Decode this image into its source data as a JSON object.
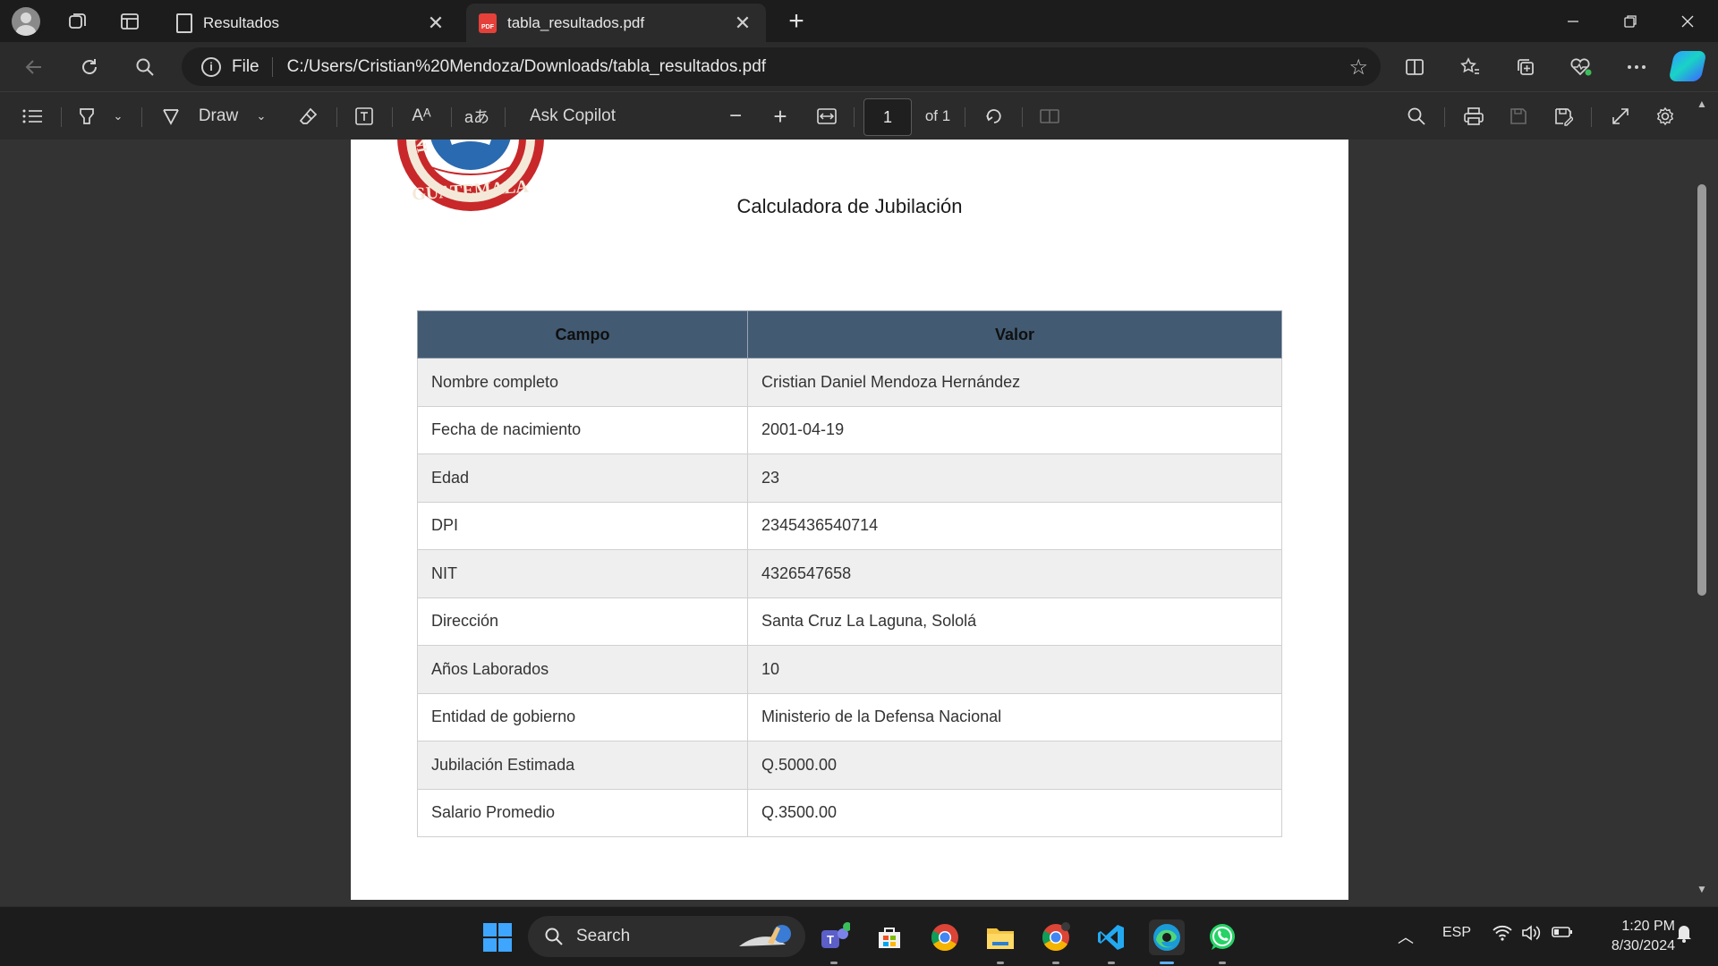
{
  "browser": {
    "tabs": [
      {
        "label": "Resultados",
        "active": false
      },
      {
        "label": "tabla_resultados.pdf",
        "active": true
      }
    ],
    "address": {
      "scheme_label": "File",
      "url": "C:/Users/Cristian%20Mendoza/Downloads/tabla_resultados.pdf"
    }
  },
  "pdf_toolbar": {
    "draw_label": "Draw",
    "ask_copilot_label": "Ask Copilot",
    "page_current": "1",
    "page_total_label": "of 1"
  },
  "document": {
    "title": "Calculadora de Jubilación",
    "seal_text": "GUATEMALA",
    "table": {
      "headers": [
        "Campo",
        "Valor"
      ],
      "rows": [
        {
          "campo": "Nombre completo",
          "valor": "Cristian Daniel Mendoza Hernández"
        },
        {
          "campo": "Fecha de nacimiento",
          "valor": "2001-04-19"
        },
        {
          "campo": "Edad",
          "valor": "23"
        },
        {
          "campo": "DPI",
          "valor": "2345436540714"
        },
        {
          "campo": "NIT",
          "valor": "4326547658"
        },
        {
          "campo": "Dirección",
          "valor": "Santa Cruz La Laguna, Sololá"
        },
        {
          "campo": "Años Laborados",
          "valor": "10"
        },
        {
          "campo": "Entidad de gobierno",
          "valor": "Ministerio de la Defensa Nacional"
        },
        {
          "campo": "Jubilación Estimada",
          "valor": "Q.5000.00"
        },
        {
          "campo": "Salario Promedio",
          "valor": "Q.3500.00"
        }
      ]
    }
  },
  "taskbar": {
    "search_label": "Search",
    "language": "ESP",
    "time": "1:20 PM",
    "date": "8/30/2024"
  },
  "colors": {
    "table_header_bg": "#425a72",
    "row_alt_bg": "#efefef",
    "accent": "#3ea6ff"
  }
}
